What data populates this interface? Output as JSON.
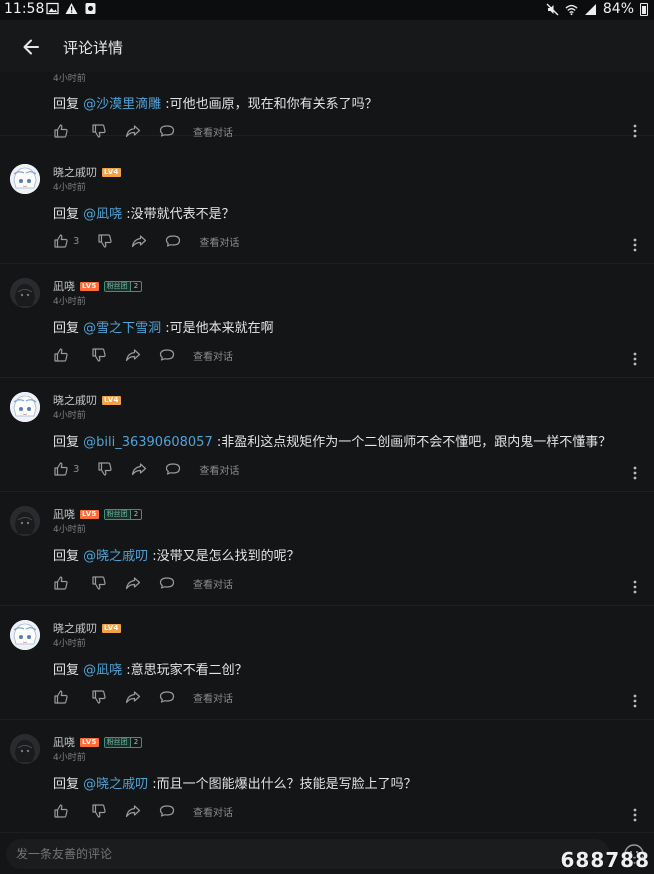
{
  "status_bar": {
    "time": "11:58",
    "battery": "84%"
  },
  "header": {
    "title": "评论详情"
  },
  "replies": [
    {
      "time": "4小时前",
      "prefix": "回复 ",
      "mention": "@沙漠里滴雕",
      "text": " :可他也画原，现在和你有关系了吗？",
      "likes": "",
      "view_dialog": "查看对话"
    },
    {
      "user": "晓之戚叨",
      "level": "LV4",
      "time": "4小时前",
      "prefix": "回复 ",
      "mention": "@凪哓",
      "text": " :没带就代表不是？",
      "likes": "3",
      "view_dialog": "查看对话"
    },
    {
      "user": "凪哓",
      "level": "LV5",
      "fan_badge": "粉丝团",
      "fan_level": "2",
      "time": "4小时前",
      "prefix": "回复 ",
      "mention": "@雪之下雪洞",
      "text": " :可是他本来就在啊",
      "likes": "",
      "view_dialog": "查看对话"
    },
    {
      "user": "晓之戚叨",
      "level": "LV4",
      "time": "4小时前",
      "prefix": "回复 ",
      "mention": "@bili_36390608057",
      "text": " :非盈利这点规矩作为一个二创画师不会不懂吧，跟内鬼一样不懂事？",
      "likes": "3",
      "view_dialog": "查看对话"
    },
    {
      "user": "凪哓",
      "level": "LV5",
      "fan_badge": "粉丝团",
      "fan_level": "2",
      "time": "4小时前",
      "prefix": "回复 ",
      "mention": "@晓之戚叨",
      "text": " :没带又是怎么找到的呢？",
      "likes": "",
      "view_dialog": "查看对话"
    },
    {
      "user": "晓之戚叨",
      "level": "LV4",
      "time": "4小时前",
      "prefix": "回复 ",
      "mention": "@凪哓",
      "text": " :意思玩家不看二创？",
      "likes": "",
      "view_dialog": "查看对话"
    },
    {
      "user": "凪哓",
      "level": "LV5",
      "fan_badge": "粉丝团",
      "fan_level": "2",
      "time": "4小时前",
      "prefix": "回复 ",
      "mention": "@晓之戚叨",
      "text": " :而且一个图能爆出什么？技能是写脸上了吗？",
      "likes": "",
      "view_dialog": "查看对话"
    }
  ],
  "comment_input": {
    "placeholder": "发一条友善的评论"
  },
  "watermark": "688788"
}
